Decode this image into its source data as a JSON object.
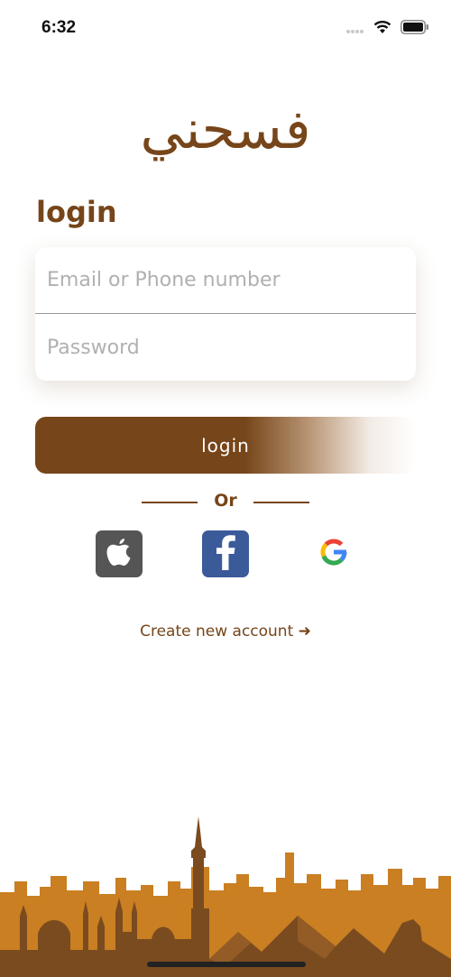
{
  "status": {
    "time": "6:32",
    "icons": [
      "cellular-dots-icon",
      "wifi-icon",
      "battery-icon"
    ]
  },
  "brand": {
    "logo_text": "فسحني",
    "color": "#764519"
  },
  "login": {
    "title": "login",
    "email_placeholder": "Email or Phone number",
    "password_placeholder": "Password",
    "button_label": "login"
  },
  "divider": {
    "label": "Or"
  },
  "social": [
    "apple-icon",
    "facebook-icon",
    "google-icon"
  ],
  "links": {
    "create_account": "Create new account ➜"
  },
  "colors": {
    "primary": "#764519",
    "skyline_back": "#c97f22",
    "skyline_front": "#7a4b1f",
    "facebook": "#3b5a9a",
    "apple": "#555555"
  }
}
